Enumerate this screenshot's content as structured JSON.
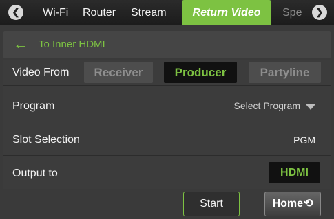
{
  "nav": {
    "prev_icon": "chevron-left",
    "next_icon": "chevron-right",
    "tabs": [
      {
        "label": "Wi-Fi"
      },
      {
        "label": "Router"
      },
      {
        "label": "Stream"
      },
      {
        "label": "Return Video",
        "active": true
      },
      {
        "label": "Spe"
      }
    ]
  },
  "header": {
    "back_icon": "arrow-left",
    "title": "To Inner HDMI"
  },
  "video_from": {
    "label": "Video From",
    "options": [
      "Receiver",
      "Producer",
      "Partyline"
    ],
    "selected": "Producer"
  },
  "program": {
    "label": "Program",
    "placeholder": "Select Program",
    "caret_icon": "caret-down"
  },
  "slot": {
    "label": "Slot Selection",
    "value": "PGM"
  },
  "output": {
    "label": "Output to",
    "value": "HDMI"
  },
  "footer": {
    "start_label": "Start",
    "home_label": "Home",
    "home_icon": "return-arrow"
  },
  "colors": {
    "accent": "#7dc242",
    "background": "#3a3a3a",
    "selected_bg": "#111111"
  }
}
